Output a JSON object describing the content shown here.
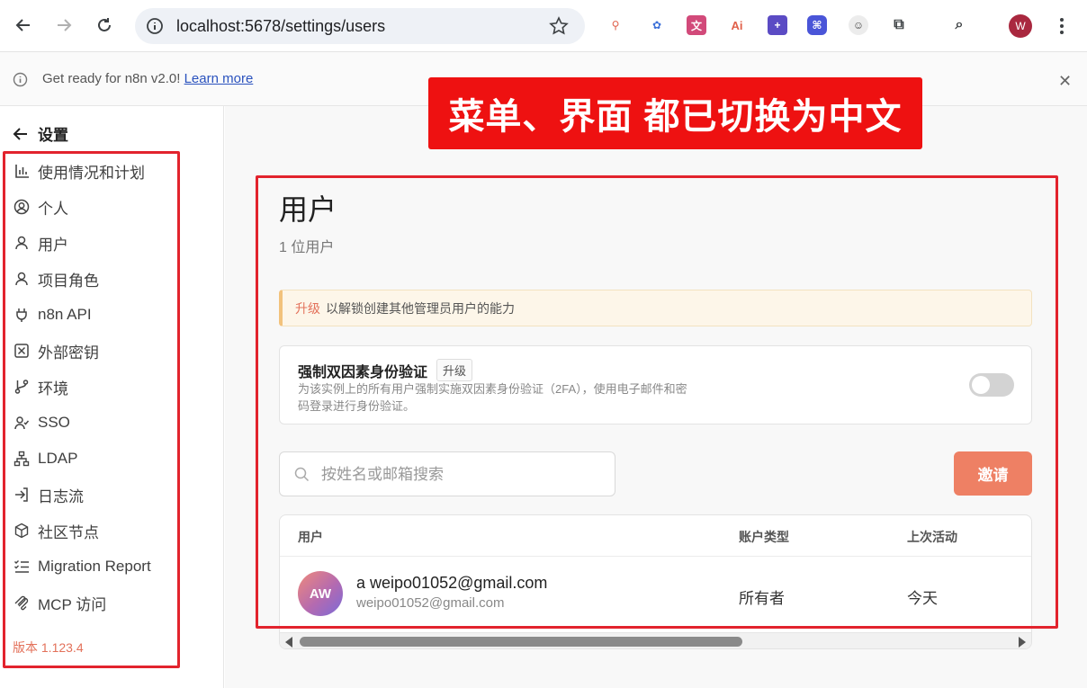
{
  "browser": {
    "url": "localhost:5678/settings/users",
    "profile_initial": "W",
    "extensions": [
      {
        "icon": "pin-extension-icon",
        "color": "#e0604a"
      },
      {
        "icon": "octopus-extension-icon",
        "color": "#3b6fd8"
      },
      {
        "icon": "translate-extension-icon",
        "color": "#d24a7a"
      },
      {
        "icon": "ai-extension-icon",
        "color": "#e0604a"
      },
      {
        "icon": "plus-square-extension-icon",
        "color": "#5b4bc4"
      },
      {
        "icon": "grid-extension-icon",
        "color": "#4a55d8"
      },
      {
        "icon": "avatar-extension-icon",
        "color": "#555555"
      },
      {
        "icon": "puzzle-extensions-icon",
        "color": "#3c4043"
      },
      {
        "icon": "tab-search-icon",
        "color": "#3c4043"
      }
    ]
  },
  "banner": {
    "text": "Get ready for n8n v2.0!",
    "link": "Learn more"
  },
  "callout": "菜单、界面 都已切换为中文",
  "sidebar": {
    "back_label": "设置",
    "items": [
      {
        "label": "使用情况和计划",
        "icon": "bar-chart-icon"
      },
      {
        "label": "个人",
        "icon": "user-circle-icon"
      },
      {
        "label": "用户",
        "icon": "user-icon"
      },
      {
        "label": "项目角色",
        "icon": "user-role-icon"
      },
      {
        "label": "n8n API",
        "icon": "plug-icon"
      },
      {
        "label": "外部密钥",
        "icon": "vault-icon"
      },
      {
        "label": "环境",
        "icon": "git-branch-icon"
      },
      {
        "label": "SSO",
        "icon": "users-sso-icon"
      },
      {
        "label": "LDAP",
        "icon": "network-icon"
      },
      {
        "label": "日志流",
        "icon": "sign-in-icon"
      },
      {
        "label": "社区节点",
        "icon": "cube-icon"
      },
      {
        "label": "Migration Report",
        "icon": "list-check-icon"
      },
      {
        "label": "MCP 访问",
        "icon": "mcp-icon"
      }
    ],
    "version": "版本 1.123.4"
  },
  "main": {
    "title": "用户",
    "subtitle": "1 位用户",
    "upgrade_link": "升级",
    "upgrade_text": "以解锁创建其他管理员用户的能力",
    "twofa": {
      "title": "强制双因素身份验证",
      "badge": "升级",
      "description": "为该实例上的所有用户强制实施双因素身份验证（2FA），使用电子邮件和密码登录进行身份验证。",
      "enabled": false
    },
    "search_placeholder": "按姓名或邮箱搜索",
    "invite_label": "邀请",
    "table": {
      "headers": [
        "用户",
        "账户类型",
        "上次活动"
      ],
      "rows": [
        {
          "initials": "AW",
          "name": "a weipo01052@gmail.com",
          "email": "weipo01052@gmail.com",
          "role": "所有者",
          "last_active": "今天"
        }
      ]
    }
  }
}
